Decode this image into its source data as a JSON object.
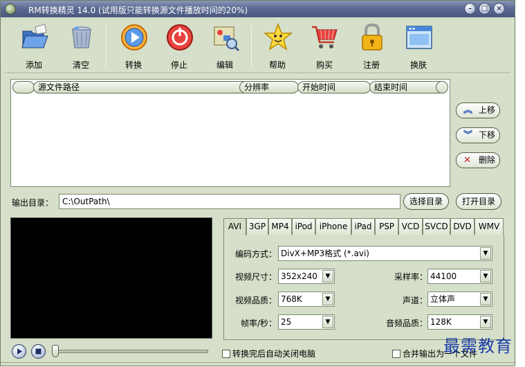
{
  "window": {
    "title": "RM转换精灵 14.0 (试用版只能转换源文件播放时间的20%)",
    "controls": [
      "minimize",
      "maximize",
      "close"
    ]
  },
  "toolbar": {
    "items": [
      {
        "label": "添加",
        "icon": "folder-open-icon"
      },
      {
        "label": "清空",
        "icon": "trash-can-icon"
      },
      {
        "label": "转换",
        "icon": "play-circle-icon"
      },
      {
        "label": "停止",
        "icon": "power-stop-icon"
      },
      {
        "label": "编辑",
        "icon": "edit-tools-icon"
      },
      {
        "label": "帮助",
        "icon": "star-face-icon"
      },
      {
        "label": "购买",
        "icon": "shopping-cart-icon"
      },
      {
        "label": "注册",
        "icon": "padlock-icon"
      },
      {
        "label": "换肤",
        "icon": "skin-window-icon"
      }
    ]
  },
  "file_list": {
    "columns": [
      "",
      "源文件路径",
      "分辨率",
      "开始时间",
      "结束时间",
      ""
    ],
    "rows": []
  },
  "side_buttons": {
    "move_up": "上移",
    "move_down": "下移",
    "delete": "删除"
  },
  "output": {
    "label": "输出目录：",
    "path": "C:\\OutPath\\",
    "choose_button": "选择目录",
    "open_button": "打开目录"
  },
  "format_tabs": [
    "AVI",
    "3GP",
    "MP4",
    "iPod",
    "iPhone",
    "iPad",
    "PSP",
    "VCD",
    "SVCD",
    "DVD",
    "WMV"
  ],
  "selected_tab": "AVI",
  "settings": {
    "codec_label": "编码方式：",
    "codec_value": "DivX+MP3格式 (*.avi)",
    "video_size_label": "视频尺寸：",
    "video_size_value": "352x240",
    "video_quality_label": "视频品质：",
    "video_quality_value": "768K",
    "framerate_label": "帧率/秒：",
    "framerate_value": "25",
    "samplerate_label": "采样率：",
    "samplerate_value": "44100",
    "channel_label": "声道：",
    "channel_value": "立体声",
    "audio_quality_label": "音频品质：",
    "audio_quality_value": "128K"
  },
  "player": {
    "position_fraction": 0.0
  },
  "options": {
    "shutdown_after": "转换完后自动关闭电脑",
    "merge_output": "合并输出为一个文件"
  },
  "watermark": "最需教育",
  "colors": {
    "window_bg": "#d6dfc9",
    "titlebar": "#5d6b93",
    "accent_blue": "#1b3da6"
  }
}
